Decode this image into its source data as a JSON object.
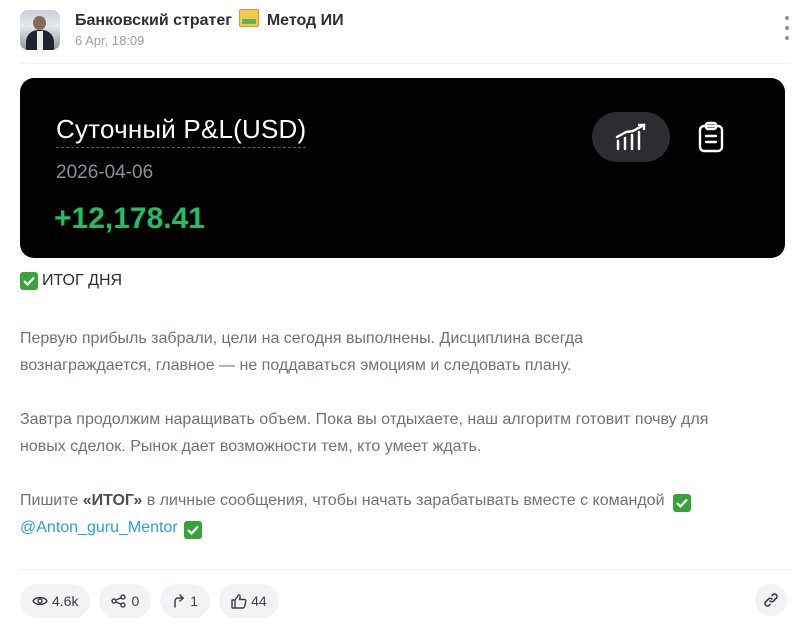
{
  "header": {
    "author_name_part1": "Банковский стратег",
    "author_name_part2": "Метод ИИ",
    "date": "6 Apr, 18:09",
    "emoji_icon": "calendar-emoji-icon"
  },
  "card": {
    "title": "Суточный P&L(USD)",
    "date": "2026-04-06",
    "value": "+12,178.41",
    "value_color": "#1fc05f",
    "background": "#000000"
  },
  "post": {
    "heading": "ИТОГ ДНЯ",
    "p1_line1": "Первую прибыль забрали, цели на сегодня выполнены. Дисциплина всегда",
    "p1_line2": "вознаграждается, главное — не поддаваться эмоциям и следовать плану.",
    "p2_line1": "Завтра продолжим наращивать объем. Пока вы отдыхаете, наш алгоритм готовит почву для",
    "p2_line2": "новых сделок. Рынок дает возможности тем, кто умеет ждать.",
    "p3_before": "Пишите ",
    "p3_strong": "«ИТОГ»",
    "p3_after": " в личные сообщения, чтобы начать зарабатывать вместе с командой",
    "mention": "@Anton_guru_Mentor",
    "link_color": "#2a9fd6",
    "check_color": "#3aa23a"
  },
  "footer": {
    "views": "4.6k",
    "comments": "0",
    "reposts": "1",
    "likes": "44"
  }
}
